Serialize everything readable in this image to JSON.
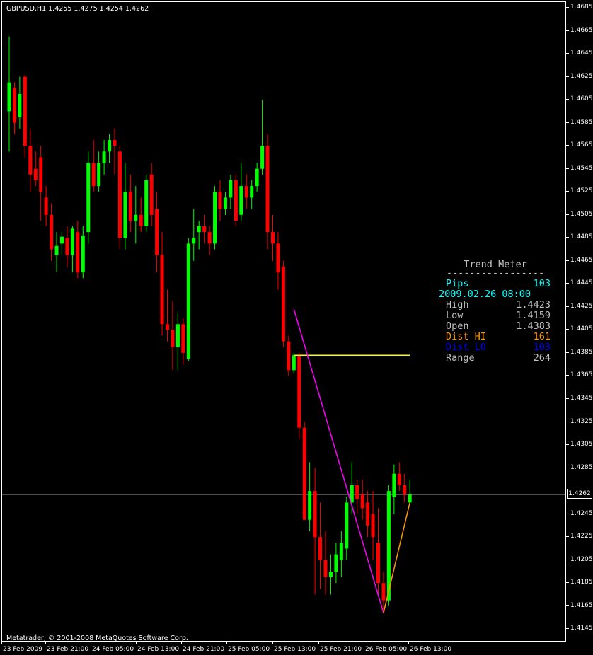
{
  "symbol_info": "GBPUSD,H1  1.4255 1.4275 1.4254 1.4262",
  "copyright": "Metatrader, © 2001-2008 MetaQuotes Software Corp.",
  "current_price_label": "1.4262",
  "current_price": 1.4262,
  "price_axis": {
    "labels": [
      "1.4685",
      "1.4665",
      "1.4645",
      "1.4625",
      "1.4605",
      "1.4585",
      "1.4565",
      "1.4545",
      "1.4525",
      "1.4505",
      "1.4485",
      "1.4465",
      "1.4445",
      "1.4425",
      "1.4405",
      "1.4385",
      "1.4365",
      "1.4345",
      "1.4325",
      "1.4305",
      "1.4285",
      "1.4245",
      "1.4225",
      "1.4205",
      "1.4185",
      "1.4165",
      "1.4145"
    ]
  },
  "time_axis": {
    "labels": [
      "23 Feb 2009",
      "23 Feb 21:00",
      "24 Feb 05:00",
      "24 Feb 13:00",
      "24 Feb 21:00",
      "25 Feb 05:00",
      "25 Feb 13:00",
      "25 Feb 21:00",
      "26 Feb 05:00",
      "26 Feb 13:00"
    ]
  },
  "colors": {
    "background": "#000000",
    "bull": "#00ff00",
    "bear": "#ff0000",
    "wick_bull": "#00ff00",
    "wick_bear": "#ff0000",
    "zigzag_down": "#ff00ff",
    "zigzag_up": "#ff9900",
    "open_line": "#ffff00",
    "bid_line": "#c0c0c0"
  },
  "trend_meter": {
    "title": "Trend Meter",
    "separator": "-----------------",
    "rows": [
      {
        "label": "Pips",
        "value": "103",
        "color": "#00ffff"
      },
      {
        "label": "2009.02.26 08:00",
        "value": "",
        "color": "#00ffff"
      },
      {
        "label": "High",
        "value": "1.4423",
        "color": "#c0c0c0"
      },
      {
        "label": "Low",
        "value": "1.4159",
        "color": "#c0c0c0"
      },
      {
        "label": "Open",
        "value": "1.4383",
        "color": "#c0c0c0"
      },
      {
        "label": "Dist HI",
        "value": "161",
        "color": "#ff9900"
      },
      {
        "label": "Dist LO",
        "value": "103",
        "color": "#0000ff"
      },
      {
        "label": "Range",
        "value": "264",
        "color": "#c0c0c0"
      }
    ]
  },
  "chart_data": {
    "type": "candlestick",
    "title": "GBPUSD,H1",
    "ylim": [
      1.4135,
      1.4695
    ],
    "candles": [
      [
        1.4595,
        1.466,
        1.456,
        1.462
      ],
      [
        1.4615,
        1.462,
        1.4575,
        1.4585
      ],
      [
        1.459,
        1.4625,
        1.458,
        1.461
      ],
      [
        1.4625,
        1.4627,
        1.4555,
        1.4565
      ],
      [
        1.4565,
        1.458,
        1.4525,
        1.454
      ],
      [
        1.4545,
        1.456,
        1.453,
        1.4535
      ],
      [
        1.4555,
        1.4565,
        1.45,
        1.4525
      ],
      [
        1.452,
        1.453,
        1.4495,
        1.4505
      ],
      [
        1.4505,
        1.4515,
        1.4465,
        1.4475
      ],
      [
        1.447,
        1.449,
        1.4455,
        1.4478
      ],
      [
        1.448,
        1.449,
        1.447,
        1.4486
      ],
      [
        1.4485,
        1.4495,
        1.446,
        1.447
      ],
      [
        1.447,
        1.4495,
        1.4455,
        1.4493
      ],
      [
        1.449,
        1.45,
        1.445,
        1.4455
      ],
      [
        1.4455,
        1.4495,
        1.445,
        1.4487
      ],
      [
        1.449,
        1.456,
        1.448,
        1.455
      ],
      [
        1.455,
        1.457,
        1.4525,
        1.453
      ],
      [
        1.453,
        1.456,
        1.4525,
        1.455
      ],
      [
        1.455,
        1.457,
        1.454,
        1.456
      ],
      [
        1.456,
        1.4575,
        1.455,
        1.457
      ],
      [
        1.457,
        1.458,
        1.454,
        1.4565
      ],
      [
        1.456,
        1.4565,
        1.4475,
        1.4485
      ],
      [
        1.4485,
        1.455,
        1.4475,
        1.4525
      ],
      [
        1.4525,
        1.454,
        1.449,
        1.45
      ],
      [
        1.45,
        1.453,
        1.448,
        1.4505
      ],
      [
        1.4505,
        1.452,
        1.449,
        1.4495
      ],
      [
        1.4495,
        1.454,
        1.449,
        1.4535
      ],
      [
        1.454,
        1.455,
        1.4495,
        1.4505
      ],
      [
        1.451,
        1.4525,
        1.4455,
        1.447
      ],
      [
        1.447,
        1.449,
        1.44,
        1.441
      ],
      [
        1.441,
        1.444,
        1.4395,
        1.4405
      ],
      [
        1.4405,
        1.443,
        1.437,
        1.439
      ],
      [
        1.439,
        1.442,
        1.437,
        1.441
      ],
      [
        1.441,
        1.4415,
        1.4375,
        1.4385
      ],
      [
        1.438,
        1.4485,
        1.4378,
        1.448
      ],
      [
        1.448,
        1.451,
        1.4465,
        1.4485
      ],
      [
        1.449,
        1.45,
        1.4475,
        1.4495
      ],
      [
        1.4495,
        1.4505,
        1.448,
        1.449
      ],
      [
        1.449,
        1.4495,
        1.447,
        1.448
      ],
      [
        1.448,
        1.453,
        1.4475,
        1.4525
      ],
      [
        1.4525,
        1.4535,
        1.45,
        1.451
      ],
      [
        1.451,
        1.4525,
        1.4505,
        1.452
      ],
      [
        1.452,
        1.454,
        1.451,
        1.4535
      ],
      [
        1.4535,
        1.454,
        1.4495,
        1.45
      ],
      [
        1.4505,
        1.455,
        1.45,
        1.453
      ],
      [
        1.453,
        1.454,
        1.451,
        1.452
      ],
      [
        1.452,
        1.4535,
        1.451,
        1.453
      ],
      [
        1.453,
        1.455,
        1.4525,
        1.4545
      ],
      [
        1.4545,
        1.4605,
        1.454,
        1.4565
      ],
      [
        1.4565,
        1.4575,
        1.4475,
        1.449
      ],
      [
        1.449,
        1.4505,
        1.4465,
        1.448
      ],
      [
        1.448,
        1.449,
        1.444,
        1.4455
      ],
      [
        1.446,
        1.4465,
        1.439,
        1.4395
      ],
      [
        1.4395,
        1.44,
        1.4365,
        1.437
      ],
      [
        1.437,
        1.4385,
        1.4367,
        1.4383
      ],
      [
        1.4383,
        1.4385,
        1.431,
        1.432
      ],
      [
        1.432,
        1.4325,
        1.424,
        1.424
      ],
      [
        1.424,
        1.429,
        1.423,
        1.4265
      ],
      [
        1.4265,
        1.4285,
        1.4175,
        1.4225
      ],
      [
        1.4225,
        1.4255,
        1.418,
        1.4205
      ],
      [
        1.4205,
        1.423,
        1.4175,
        1.419
      ],
      [
        1.419,
        1.421,
        1.4175,
        1.4195
      ],
      [
        1.4195,
        1.422,
        1.4185,
        1.421
      ],
      [
        1.4205,
        1.423,
        1.419,
        1.422
      ],
      [
        1.4215,
        1.426,
        1.4205,
        1.4255
      ],
      [
        1.4255,
        1.429,
        1.4245,
        1.427
      ],
      [
        1.427,
        1.4275,
        1.4245,
        1.4258
      ],
      [
        1.4262,
        1.4275,
        1.424,
        1.425
      ],
      [
        1.4255,
        1.4265,
        1.4225,
        1.4235
      ],
      [
        1.4245,
        1.4265,
        1.4205,
        1.4225
      ],
      [
        1.422,
        1.425,
        1.4175,
        1.4185
      ],
      [
        1.4185,
        1.4195,
        1.4159,
        1.417
      ],
      [
        1.417,
        1.427,
        1.4165,
        1.4265
      ],
      [
        1.426,
        1.4288,
        1.4245,
        1.428
      ],
      [
        1.428,
        1.429,
        1.4265,
        1.427
      ],
      [
        1.427,
        1.428,
        1.4255,
        1.4262
      ],
      [
        1.4255,
        1.4275,
        1.4254,
        1.4262
      ]
    ],
    "zigzag_down": {
      "from_index": 54,
      "from_price": 1.4423,
      "to_index": 71,
      "to_price": 1.4159
    },
    "zigzag_up": {
      "from_index": 71,
      "from_price": 1.4159,
      "to_index": 76,
      "to_price": 1.4255
    },
    "open_level": {
      "from_index": 54,
      "to_index": 76,
      "price": 1.4383
    }
  }
}
